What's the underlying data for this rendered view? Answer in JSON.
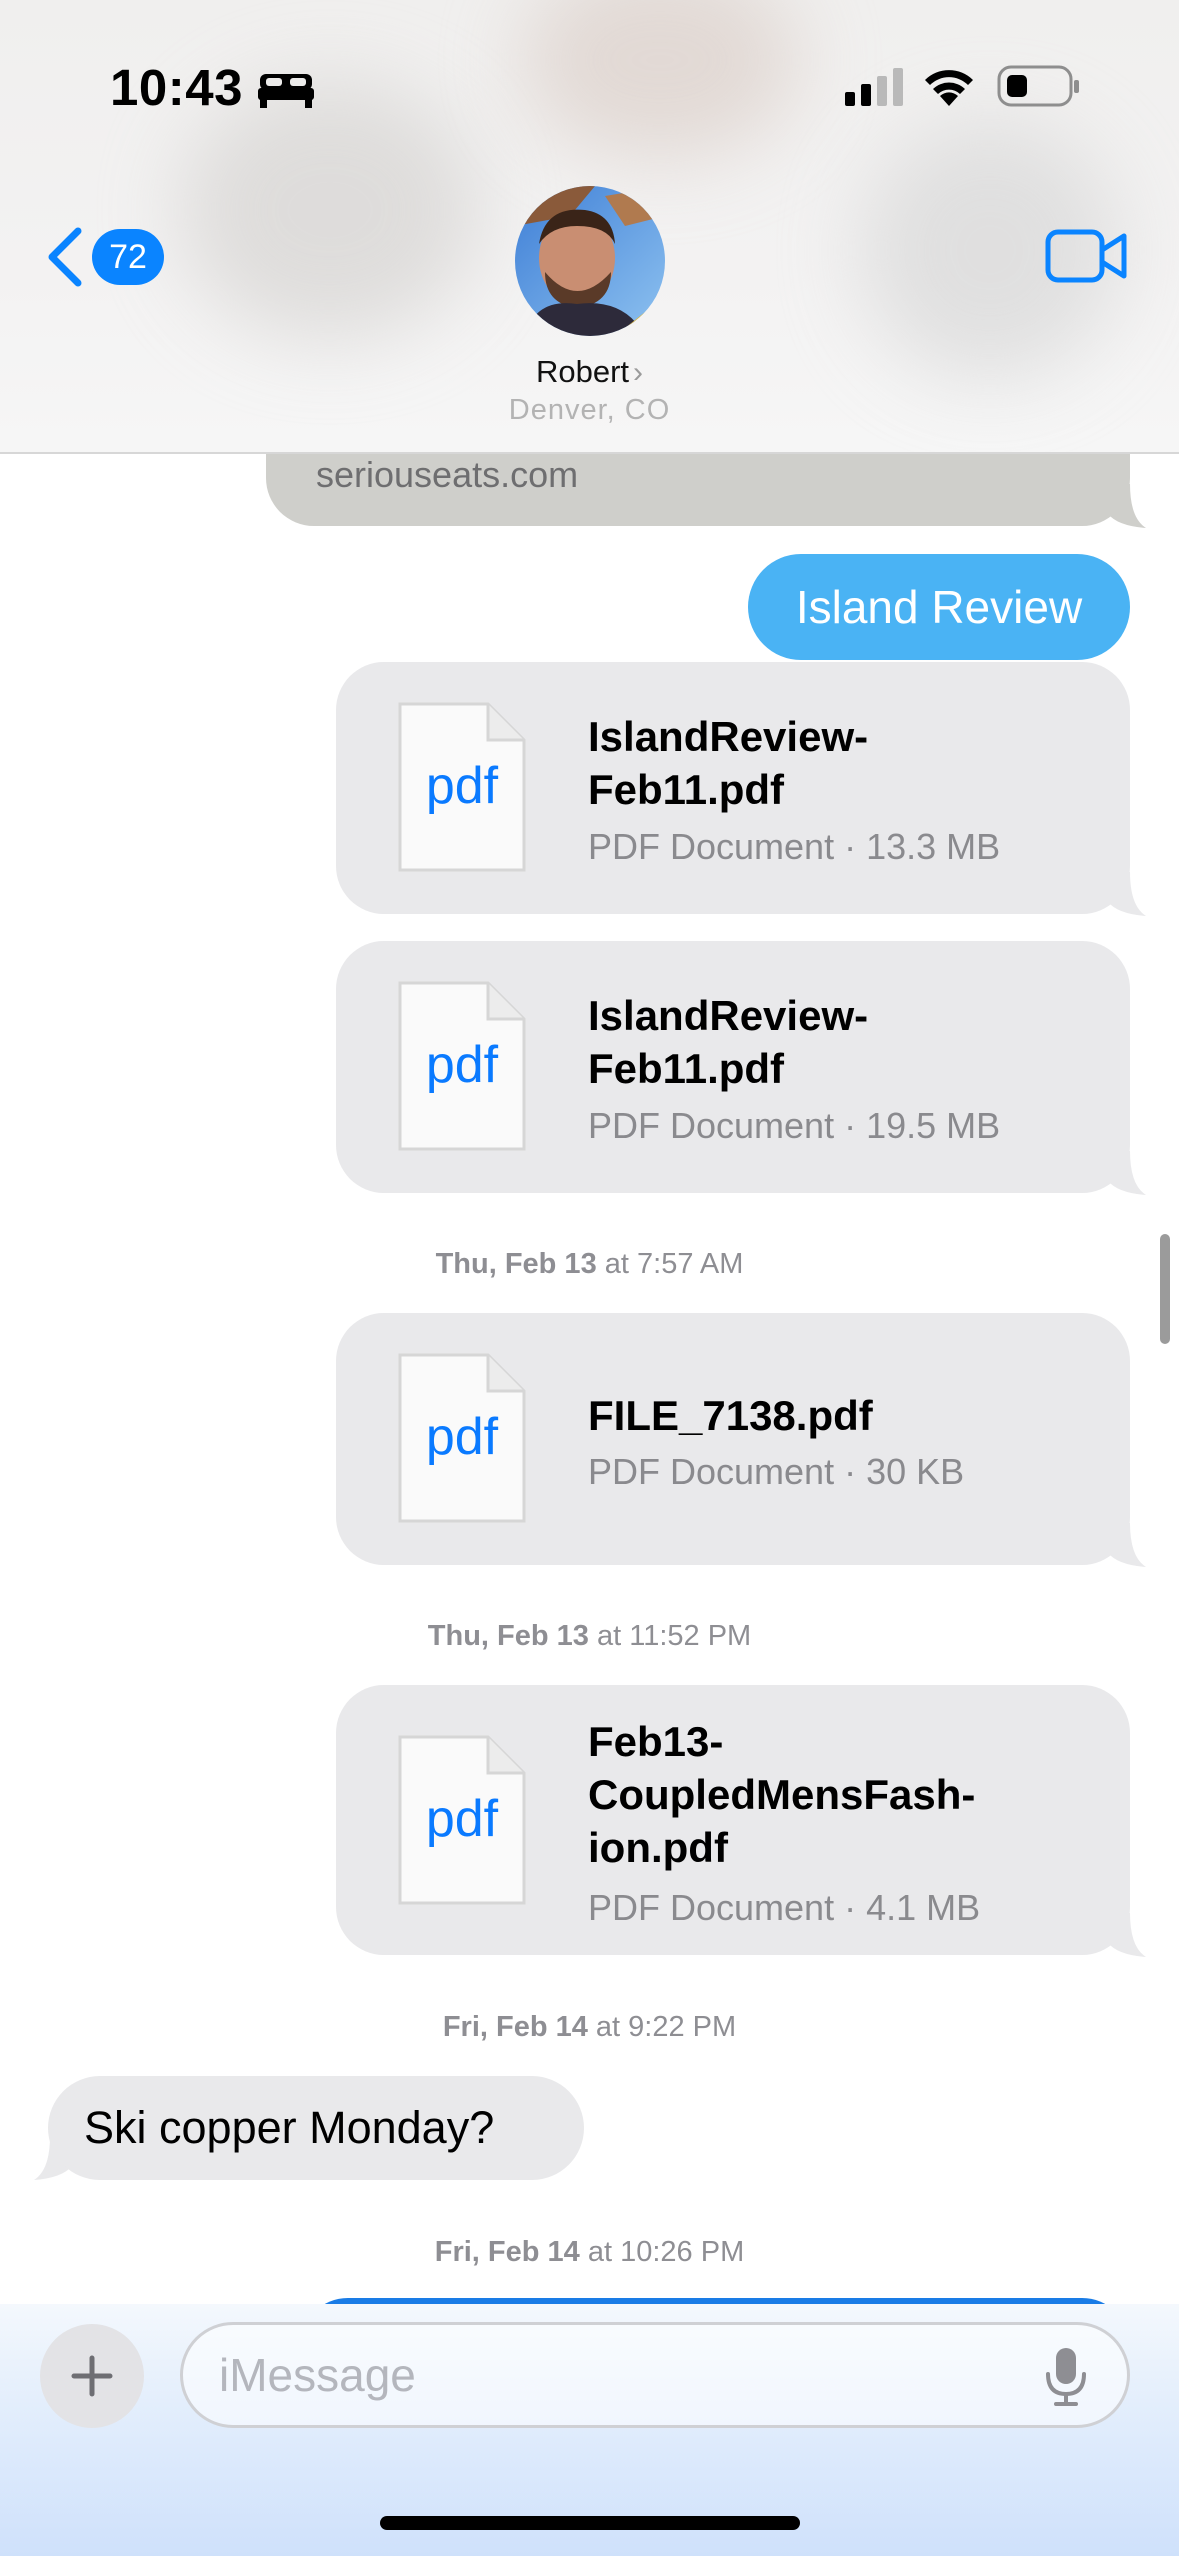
{
  "status_bar": {
    "time": "10:43"
  },
  "header": {
    "unread_count": "72",
    "contact_name": "Robert",
    "contact_location": "Denver, CO"
  },
  "messages": {
    "link_preview_domain": "seriouseats.com",
    "sent_text_1": "Island Review",
    "attachments": [
      {
        "icon_label": "pdf",
        "name": "IslandReview-Feb11.pdf",
        "name_line1": "IslandReview-",
        "name_line2": "Feb11.pdf",
        "meta": "PDF Document · 13.3 MB"
      },
      {
        "icon_label": "pdf",
        "name": "IslandReview-Feb11.pdf",
        "name_line1": "IslandReview-",
        "name_line2": "Feb11.pdf",
        "meta": "PDF Document · 19.5 MB"
      },
      {
        "icon_label": "pdf",
        "name": "FILE_7138.pdf",
        "meta": "PDF Document · 30 KB"
      },
      {
        "icon_label": "pdf",
        "name": "Feb13-CoupledMensFashion.pdf",
        "name_line1": "Feb13-",
        "name_line2": "CoupledMensFash-",
        "name_line3": "ion.pdf",
        "meta": "PDF Document · 4.1 MB"
      }
    ],
    "timestamps": [
      {
        "day": "Thu, Feb 13",
        "time": "at 7:57 AM"
      },
      {
        "day": "Thu, Feb 13",
        "time": "at 11:52 PM"
      },
      {
        "day": "Fri, Feb 14",
        "time": "at 9:22 PM"
      },
      {
        "day": "Fri, Feb 14",
        "time": "at 10:26 PM"
      }
    ],
    "received_text_1": "Ski copper Monday?"
  },
  "input": {
    "placeholder": "iMessage"
  },
  "colors": {
    "accent": "#0a84ff",
    "sent_bubble": "#4ab3f4",
    "received_bubble": "#e9e9eb"
  }
}
